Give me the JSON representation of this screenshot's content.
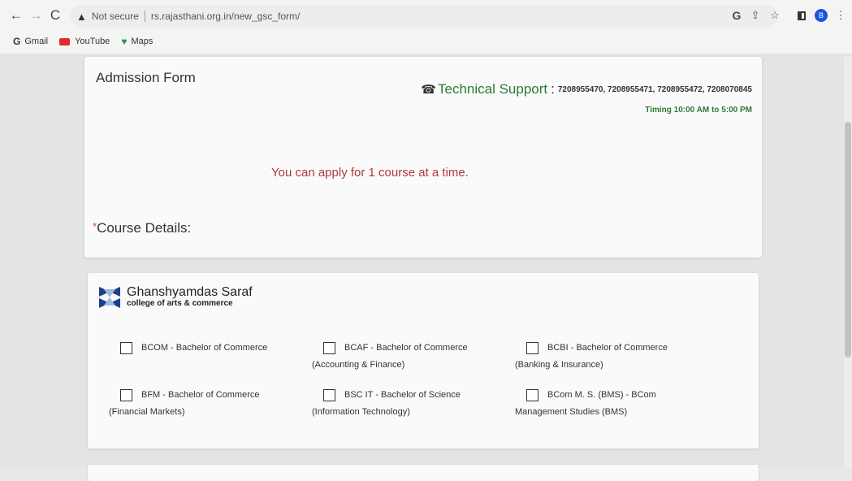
{
  "browser": {
    "not_secure": "Not secure",
    "url": "rs.rajasthani.org.in/new_gsc_form/",
    "profile_initial": "B",
    "bookmarks": [
      {
        "label": "Gmail",
        "icon": "G"
      },
      {
        "label": "YouTube",
        "icon": "youtube"
      },
      {
        "label": "Maps",
        "icon": "maps-pin"
      }
    ]
  },
  "form": {
    "title": "Admission Form",
    "support_label": "Technical Support",
    "support_numbers": "7208955470, 7208955471, 7208955472, 7208070845",
    "timing": "Timing 10:00 AM to 5:00 PM",
    "notice": "You can apply for 1 course at a time.",
    "course_details_required": "*",
    "course_details_label": "Course Details:"
  },
  "college": {
    "name_line1": "Ghanshyamdas Saraf",
    "name_line2": "college of arts & commerce"
  },
  "courses": [
    {
      "code": "BCOM",
      "text": "BCOM  - Bachelor of Commerce"
    },
    {
      "code": "BCAF",
      "text": "BCAF  - Bachelor of Commerce (Accounting & Finance)"
    },
    {
      "code": "BCBI",
      "text": "BCBI  - Bachelor of Commerce (Banking & Insurance)"
    },
    {
      "code": "BFM",
      "text": "BFM  - Bachelor of Commerce (Financial Markets)"
    },
    {
      "code": "BSC IT",
      "text": "BSC IT  - Bachelor of Science (Information Technology)"
    },
    {
      "code": "BCom M. S. (BMS)",
      "text": "BCom M. S. (BMS) - BCom Management Studies (BMS)"
    }
  ],
  "colors": {
    "support_green": "#2c7a36",
    "notice_red": "#b03a3a"
  }
}
